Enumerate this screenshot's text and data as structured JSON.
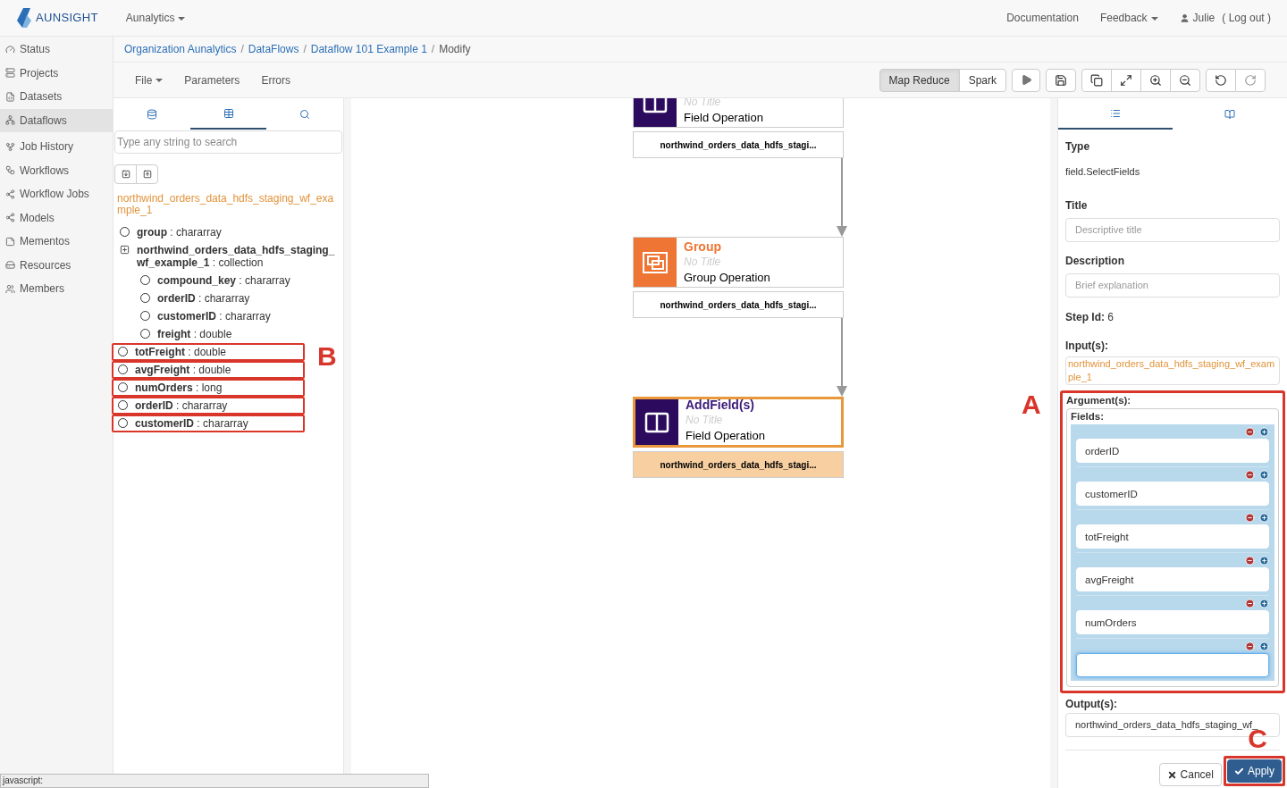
{
  "topbar": {
    "logo": "AUNSIGHT",
    "org_menu": "Aunalytics",
    "links": [
      {
        "label": "Documentation",
        "dropdown": false
      },
      {
        "label": "Feedback",
        "dropdown": true
      }
    ],
    "user": "Julie",
    "logout": "( Log out )"
  },
  "sidebar": {
    "items": [
      {
        "label": "Status",
        "selected": false
      },
      {
        "label": "Projects",
        "selected": false
      },
      {
        "label": "Datasets",
        "selected": false
      },
      {
        "label": "Dataflows",
        "selected": true
      },
      {
        "label": "Job History",
        "selected": false
      },
      {
        "label": "Workflows",
        "selected": false
      },
      {
        "label": "Workflow Jobs",
        "selected": false
      },
      {
        "label": "Models",
        "selected": false
      },
      {
        "label": "Mementos",
        "selected": false
      },
      {
        "label": "Resources",
        "selected": false
      },
      {
        "label": "Members",
        "selected": false
      }
    ]
  },
  "breadcrumb": [
    {
      "label": "Organization Aunalytics",
      "separator": "/"
    },
    {
      "label": "DataFlows",
      "separator": "/"
    },
    {
      "label": "Dataflow 101 Example 1",
      "separator": "/"
    },
    {
      "label": "Modify"
    }
  ],
  "toolbar": {
    "menus": [
      {
        "label": "File",
        "dropdown": true
      },
      {
        "label": "Parameters",
        "dropdown": false
      },
      {
        "label": "Errors",
        "dropdown": false
      }
    ],
    "engines": [
      {
        "label": "Map Reduce",
        "selected": true
      },
      {
        "label": "Spark",
        "selected": false
      }
    ]
  },
  "left_panel": {
    "tabs": [
      {
        "selected": false
      },
      {
        "selected": true
      },
      {
        "selected": false
      }
    ],
    "search": {
      "placeholder": "Type any string to search"
    },
    "dataset": "northwind_orders_data_hdfs_staging_wf_example_1",
    "tree": [
      {
        "label": "**group** : chararray",
        "highlighted": false
      },
      {
        "label": "**northwind_orders_data_hdfs_staging_wf_example_1** : collection",
        "highlighted": false,
        "children": [
          {
            "label": "**compound_key** : chararray",
            "highlighted": false
          },
          {
            "label": "**orderID** : chararray",
            "highlighted": false
          },
          {
            "label": "**customerID** : chararray",
            "highlighted": false
          },
          {
            "label": "**freight** : double",
            "highlighted": false
          }
        ]
      },
      {
        "label": "**totFreight** : double",
        "highlighted": true
      },
      {
        "label": "**avgFreight** : double",
        "highlighted": true
      },
      {
        "label": "**numOrders** : long",
        "highlighted": true
      },
      {
        "label": "**orderID** : chararray",
        "highlighted": true
      },
      {
        "label": "**customerID** : chararray",
        "highlighted": true
      }
    ],
    "annotation": "B"
  },
  "canvas": {
    "nodes": [
      {
        "kind": "field",
        "subtitle": "No Title",
        "operation": "Field Operation",
        "output": "northwind_orders_data_hdfs_stagi...",
        "selected": false
      },
      {
        "kind": "group",
        "title": "Group",
        "subtitle": "No Title",
        "operation": "Group Operation",
        "output": "northwind_orders_data_hdfs_stagi...",
        "selected": false
      },
      {
        "kind": "field",
        "title": "AddField(s)",
        "subtitle": "No Title",
        "operation": "Field Operation",
        "output": "northwind_orders_data_hdfs_stagi...",
        "selected": true
      }
    ]
  },
  "right_panel": {
    "tabs": [
      {
        "selected": true
      },
      {
        "selected": false
      }
    ],
    "type_label": "Type",
    "type_value": "field.SelectFields",
    "title_label": "Title",
    "title_placeholder": "Descriptive title",
    "description_label": "Description",
    "description_placeholder": "Brief explanation",
    "step_id_label": "Step Id:",
    "step_id": "6",
    "inputs_label": "Input(s):",
    "input": "northwind_orders_data_hdfs_staging_wf_example_1",
    "arguments_label": "Argument(s):",
    "fields_label": "Fields:",
    "fields": [
      {
        "value": "orderID",
        "focused": false
      },
      {
        "value": "customerID",
        "focused": false
      },
      {
        "value": "totFreight",
        "focused": false
      },
      {
        "value": "avgFreight",
        "focused": false
      },
      {
        "value": "numOrders",
        "focused": false
      },
      {
        "focused": true
      }
    ],
    "outputs_label": "Output(s):",
    "output": "northwind_orders_data_hdfs_staging_wf_",
    "annotation_arguments": "A",
    "annotation_apply": "C",
    "cancel": "Cancel",
    "apply": "Apply"
  },
  "status_bar": "javascript:"
}
